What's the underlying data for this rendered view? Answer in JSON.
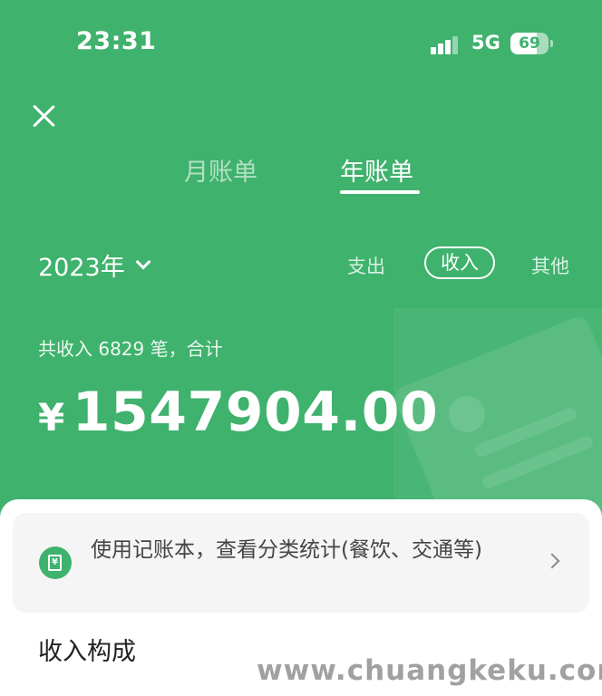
{
  "status_bar": {
    "time": "23:31",
    "network": "5G",
    "battery": "69",
    "battery_level": 0.69
  },
  "tabs": {
    "month": "月账单",
    "year": "年账单",
    "active": "year"
  },
  "year_selector": {
    "label": "2023年"
  },
  "filters": {
    "expense": "支出",
    "income": "收入",
    "other": "其他",
    "active": "income"
  },
  "summary": {
    "text": "共收入 6829 笔，合计",
    "currency": "¥",
    "amount": "1547904.00"
  },
  "promo": {
    "text": "使用记账本，查看分类统计(餐饮、交通等)",
    "icon": "ledger-icon"
  },
  "section": {
    "title": "收入构成"
  },
  "watermark": {
    "text": "www.chuangkeku.com"
  },
  "colors": {
    "brand": "#3fb26d",
    "sheet": "#ffffff",
    "card": "#f5f5f5"
  }
}
